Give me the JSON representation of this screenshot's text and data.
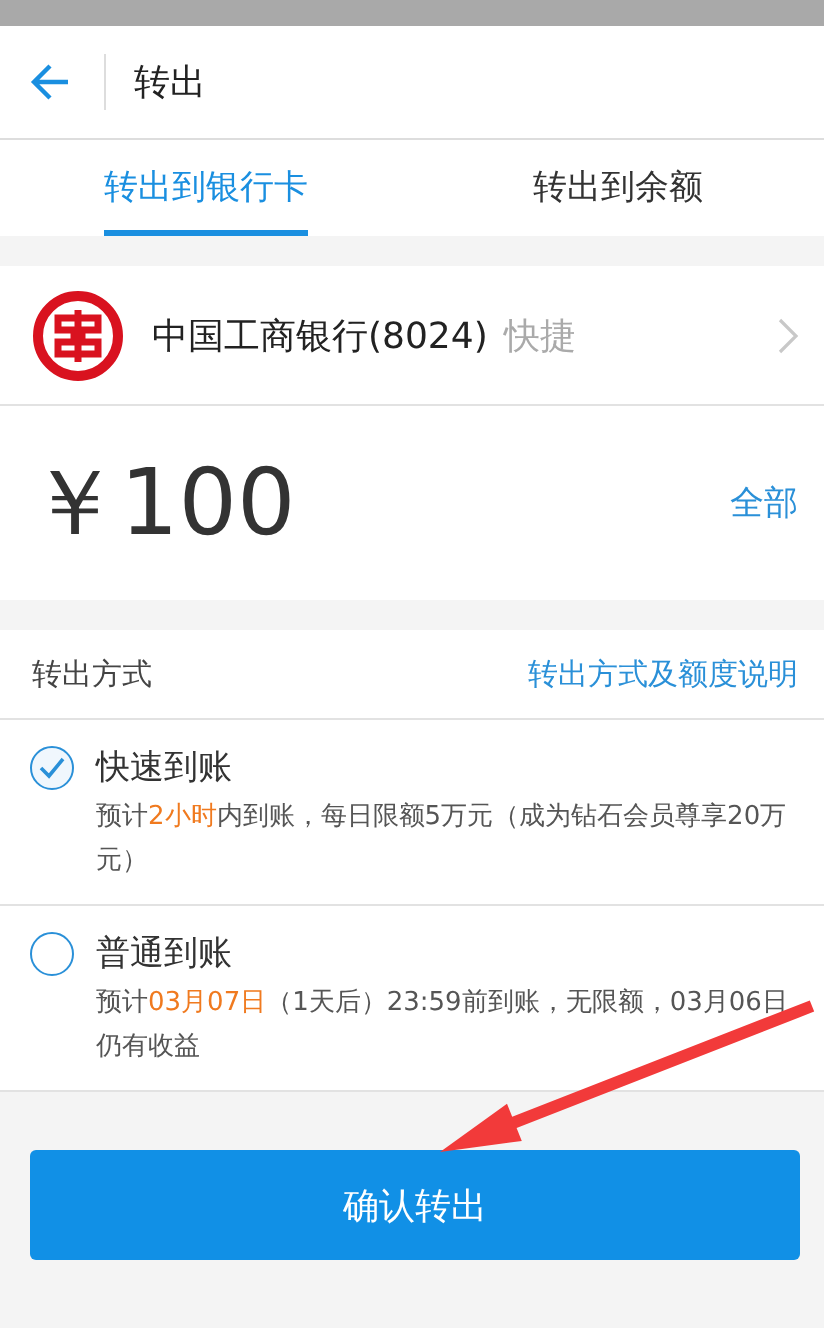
{
  "header": {
    "title": "转出"
  },
  "tabs": [
    {
      "label": "转出到银行卡",
      "selected": true
    },
    {
      "label": "转出到余额",
      "selected": false
    }
  ],
  "bank": {
    "name": "中国工商银行(8024)",
    "tag": "快捷"
  },
  "amount": {
    "value": "￥100",
    "action": "全部"
  },
  "method": {
    "title": "转出方式",
    "link": "转出方式及额度说明",
    "options": [
      {
        "name": "快速到账",
        "selected": true,
        "description": [
          {
            "text": "预计",
            "highlight": false
          },
          {
            "text": "2小时",
            "highlight": true
          },
          {
            "text": "内到账，每日限额5万元（成为钻石会员尊享20万元）",
            "highlight": false
          }
        ]
      },
      {
        "name": "普通到账",
        "selected": false,
        "description": [
          {
            "text": "预计",
            "highlight": false
          },
          {
            "text": "03月07日",
            "highlight": true
          },
          {
            "text": "（1天后）23:59前到账，无限额，03月06日仍有收益",
            "highlight": false
          }
        ]
      }
    ]
  },
  "confirm_button": "确认转出"
}
